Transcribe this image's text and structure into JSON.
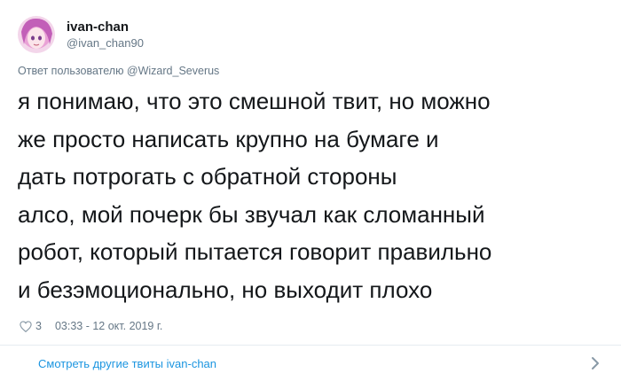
{
  "author": {
    "display_name": "ivan-chan",
    "handle": "@ivan_chan90",
    "avatar_icon": "anime-avatar"
  },
  "reply_to": "Ответ пользователю @Wizard_Severus",
  "tweet": {
    "lines": [
      "я понимаю, что это смешной твит, но можно",
      "же просто написать крупно на бумаге и",
      "дать потрогать с обратной стороны",
      "алсо, мой почерк бы звучал как сломанный",
      "робот, который пытается говорит правильно",
      "и безэмоционально, но выходит плохо"
    ]
  },
  "meta": {
    "like_icon": "heart-icon",
    "like_count": "3",
    "timestamp": "03:33 - 12 окт. 2019 г."
  },
  "footer": {
    "more_label": "Смотреть другие твиты ivan-chan",
    "chevron_icon": "chevron-right-icon"
  },
  "colors": {
    "text": "#14171a",
    "secondary": "#657786",
    "link": "#1b95e0",
    "divider": "#e6ecf0"
  }
}
